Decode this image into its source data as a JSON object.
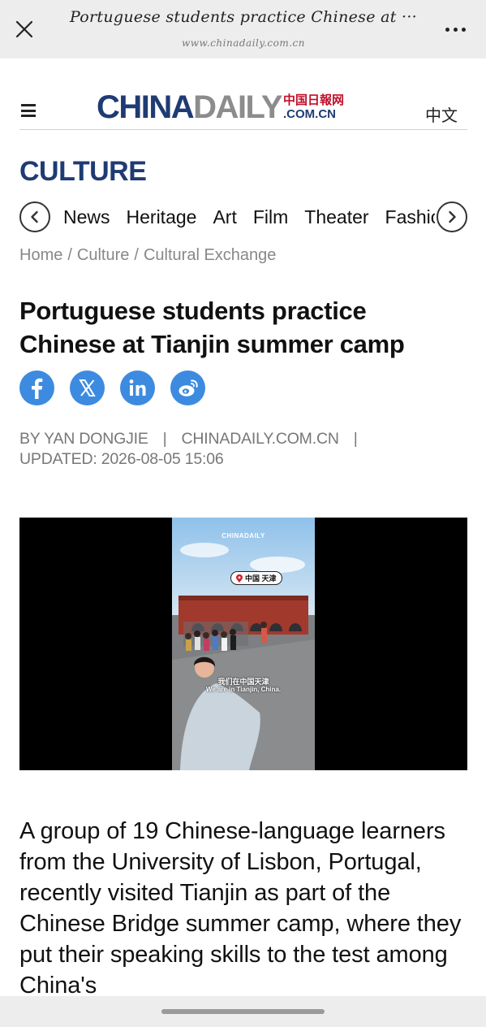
{
  "browser": {
    "title": "Portuguese students practice Chinese at ···",
    "url": "www.chinadaily.com.cn",
    "close_icon": "close-icon",
    "more_icon": "more-dots-icon"
  },
  "site": {
    "logo_main": "CHINA",
    "logo_daily": "DAILY",
    "logo_cn": "中国日報网",
    "logo_com": ".COM.CN",
    "lang_link": "中文",
    "brand_navy": "#1f3b73",
    "brand_red": "#c0102a"
  },
  "section": {
    "title": "CULTURE",
    "nav": [
      "News",
      "Heritage",
      "Art",
      "Film",
      "Theater",
      "Fashion"
    ]
  },
  "breadcrumb": [
    "Home",
    "Culture",
    "Cultural Exchange"
  ],
  "article": {
    "headline": "Portuguese students practice Chinese at Tianjin summer camp",
    "share": [
      "facebook-icon",
      "x-icon",
      "linkedin-icon",
      "weibo-icon"
    ],
    "byline_author": "BY YAN DONGJIE",
    "byline_source": "CHINADAILY.COM.CN",
    "byline_updated": "UPDATED: 2026-08-05 15:06",
    "video": {
      "watermark": "CHINADAILY",
      "location_tag": "中国 天津",
      "subtitle_cn": "我们在中国天津",
      "subtitle_en": "We are in Tianjin, China."
    },
    "body": "A group of 19 Chinese-language learners from the University of Lisbon, Portugal, recently visited Tianjin as part of the Chinese Bridge summer camp, where they put their speaking skills to the test among China's"
  }
}
